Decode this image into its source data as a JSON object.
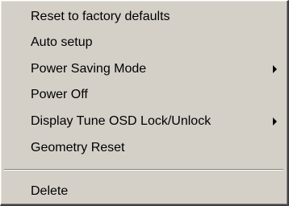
{
  "context_menu": {
    "items": [
      {
        "label": "Reset to factory defaults",
        "has_submenu": false
      },
      {
        "label": "Auto setup",
        "has_submenu": false
      },
      {
        "label": "Power Saving Mode",
        "has_submenu": true,
        "submenu_icon": "triangle-right-icon"
      },
      {
        "label": "Power Off",
        "has_submenu": false
      },
      {
        "label": "Display Tune OSD Lock/Unlock",
        "has_submenu": true,
        "submenu_icon": "triangle-right-icon"
      },
      {
        "label": "Geometry Reset",
        "has_submenu": false
      }
    ],
    "bottom_items": [
      {
        "label": "Delete",
        "has_submenu": false
      }
    ]
  },
  "colors": {
    "menu_face": "#d4d0c8",
    "text": "#000000",
    "highlight_edge": "#ffffff",
    "shadow_edge": "#808080",
    "dark_shadow": "#404040"
  }
}
